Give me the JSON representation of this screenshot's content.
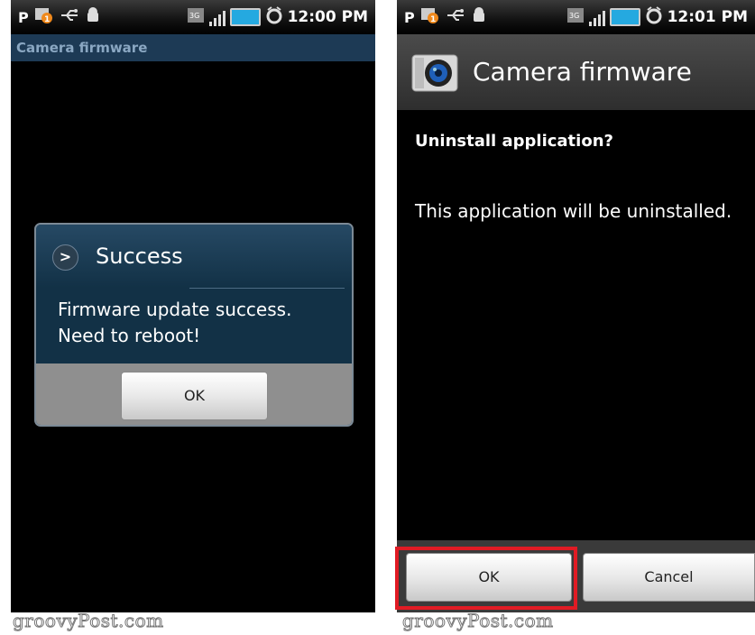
{
  "left_screen": {
    "status": {
      "time": "12:00 PM",
      "notif_letter": "P"
    },
    "app_title": "Camera firmware",
    "dialog": {
      "title": "Success",
      "message_line1": "Firmware update success.",
      "message_line2": "Need to reboot!",
      "ok_label": "OK"
    }
  },
  "right_screen": {
    "status": {
      "time": "12:01 PM",
      "notif_letter": "P"
    },
    "app_title": "Camera firmware",
    "question": "Uninstall application?",
    "info": "This application will be uninstalled.",
    "ok_label": "OK",
    "cancel_label": "Cancel"
  },
  "watermark": "groovyPost.com",
  "colors": {
    "highlight": "#e01b24",
    "battery": "#25a9e0",
    "dialog": "#123146"
  }
}
